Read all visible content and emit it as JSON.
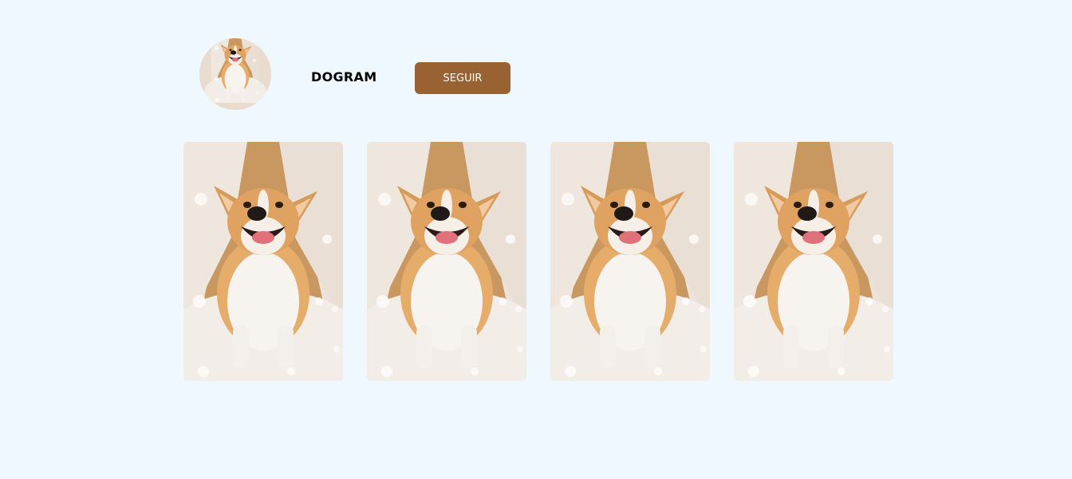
{
  "profile": {
    "name": "DOGRAM",
    "follow_label": "SEGUIR",
    "avatar_image": "corgi-photo"
  },
  "photos": [
    {
      "image": "corgi-photo"
    },
    {
      "image": "corgi-photo"
    },
    {
      "image": "corgi-photo"
    },
    {
      "image": "corgi-photo"
    }
  ],
  "colors": {
    "page_background": "#f0f8ff",
    "button_background": "#996233",
    "button_text": "#ffffff"
  }
}
